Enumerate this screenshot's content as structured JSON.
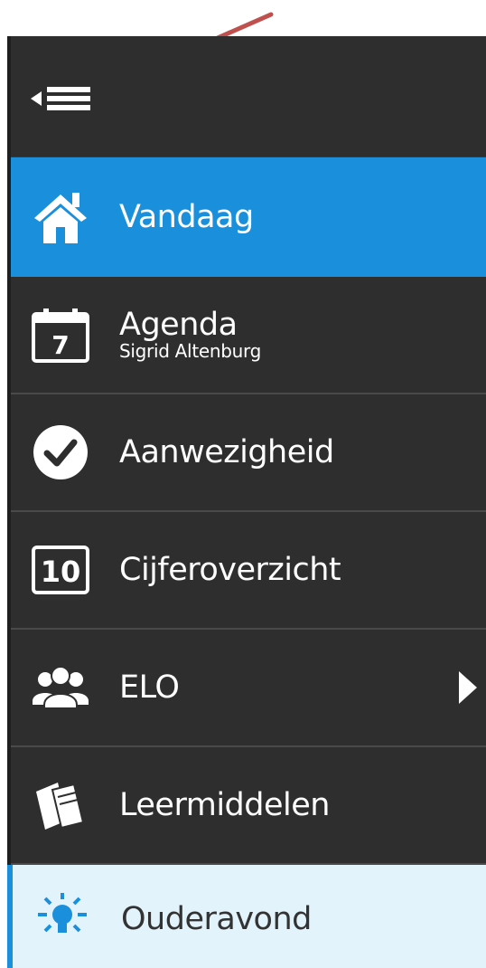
{
  "colors": {
    "sidebar_bg": "#2e2e2e",
    "active_bg": "#1a90dc",
    "highlight_bg": "#e3f3fb",
    "annotation_arrow": "#c0504d"
  },
  "sidebar": {
    "toggle_icon": "collapse-menu-icon",
    "items": [
      {
        "id": "vandaag",
        "label": "Vandaag",
        "icon": "home-icon",
        "state": "active"
      },
      {
        "id": "agenda",
        "label": "Agenda",
        "sublabel": "Sigrid Altenburg",
        "icon": "calendar-icon",
        "calendar_day": "7"
      },
      {
        "id": "aanwezigheid",
        "label": "Aanwezigheid",
        "icon": "checkmark-circle-icon"
      },
      {
        "id": "cijferoverzicht",
        "label": "Cijferoverzicht",
        "icon": "grade-icon",
        "grade_value": "10"
      },
      {
        "id": "elo",
        "label": "ELO",
        "icon": "people-icon",
        "has_submenu": true
      },
      {
        "id": "leermiddelen",
        "label": "Leermiddelen",
        "icon": "books-icon"
      },
      {
        "id": "ouderavond",
        "label": "Ouderavond",
        "icon": "lightbulb-icon",
        "state": "highlighted"
      }
    ]
  }
}
